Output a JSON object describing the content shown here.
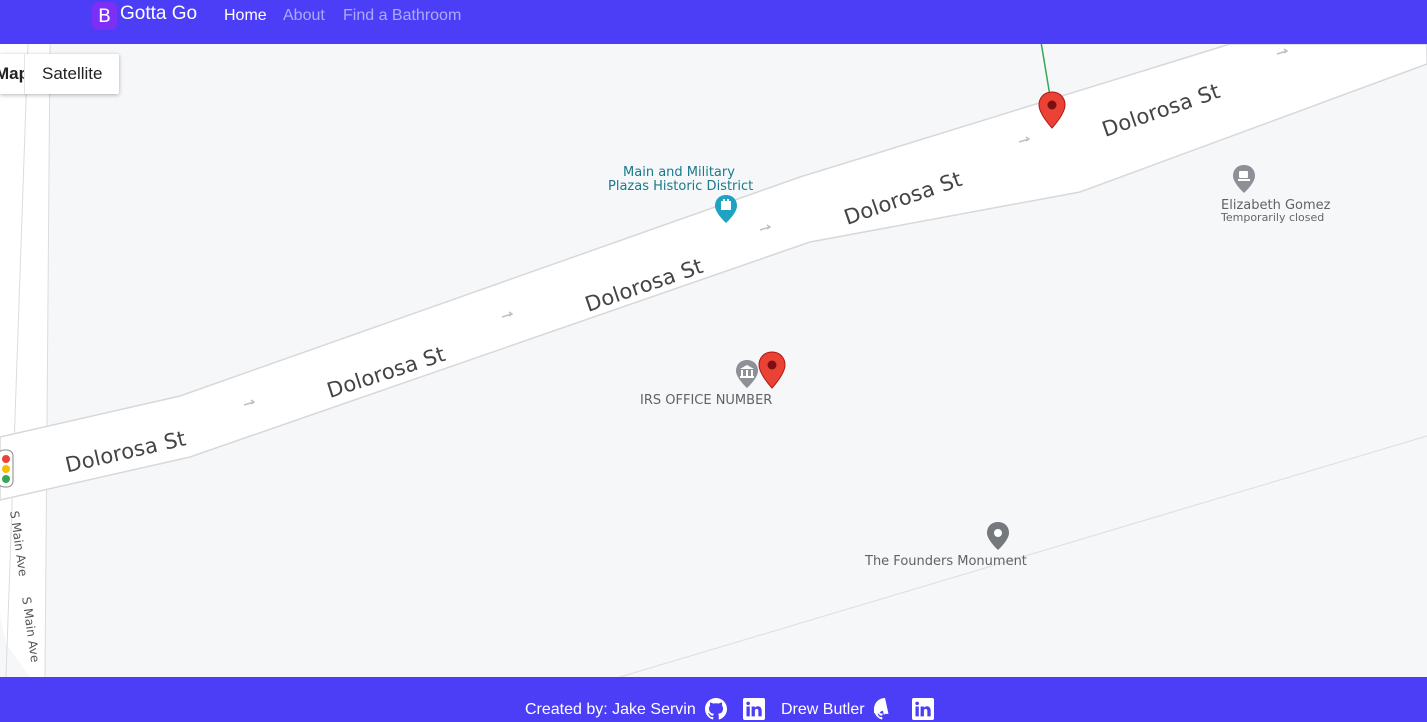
{
  "navbar": {
    "logo_letter": "B",
    "brand": "Gotta Go",
    "links": [
      {
        "label": "Home",
        "active": true
      },
      {
        "label": "About",
        "active": false
      },
      {
        "label": "Find a Bathroom",
        "active": false
      }
    ],
    "bg_color": "#4b3ef6"
  },
  "map": {
    "type_controls": {
      "map_label": "Map",
      "satellite_label": "Satellite"
    },
    "street_labels": [
      "Dolorosa St",
      "Dolorosa St",
      "Dolorosa St",
      "Dolorosa St",
      "Dolorosa St"
    ],
    "side_street_labels": [
      "S Main Ave",
      "S Main Ave"
    ],
    "pois": [
      {
        "name": "Main and Military Plazas Historic District",
        "line1": "Main and Military",
        "line2": "Plazas Historic District",
        "icon": "landmark-icon",
        "color": "#1a7a8c"
      },
      {
        "name": "Elizabeth Gomez",
        "status": "Temporarily closed",
        "icon": "cafe-icon",
        "color": "#70757a"
      },
      {
        "name": "IRS OFFICE NUMBER",
        "icon": "government-icon",
        "color": "#5f6368"
      },
      {
        "name": "The Founders Monument",
        "icon": "monument-icon",
        "color": "#5f6368"
      }
    ],
    "markers": [
      "red-pin-marker",
      "red-pin-marker"
    ]
  },
  "footer": {
    "credit_prefix": "Created by: Jake Servin",
    "second_author": "Drew Butler",
    "icons": [
      "github-icon",
      "linkedin-icon",
      "github-icon",
      "linkedin-icon"
    ]
  }
}
